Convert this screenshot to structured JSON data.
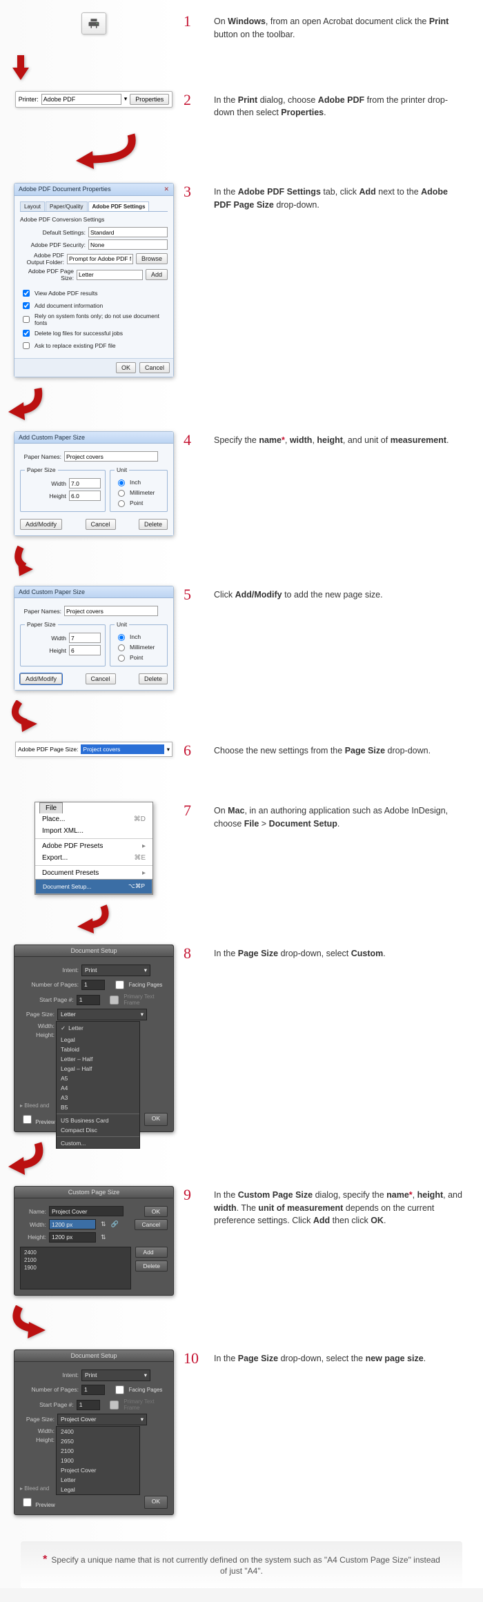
{
  "steps": [
    {
      "n": "1",
      "html": "On <b>Windows</b>, from an open Acrobat document click the <b>Print</b> button on the toolbar."
    },
    {
      "n": "2",
      "html": "In the <b>Print</b> dialog, choose <b>Adobe PDF</b> from the printer drop-down then select <b>Properties</b>."
    },
    {
      "n": "3",
      "html": "In the <b>Adobe PDF Settings</b> tab, click <b>Add</b> next to the <b>Adobe PDF Page Size</b> drop-down."
    },
    {
      "n": "4",
      "html": "Specify the <b>name</b><span class='ast'>*</span>, <b>width</b>, <b>height</b>, and unit of <b>measurement</b>."
    },
    {
      "n": "5",
      "html": "Click <b>Add/Modify</b> to add the new page size."
    },
    {
      "n": "6",
      "html": "Choose the new settings from the <b>Page Size</b> drop-down."
    },
    {
      "n": "7",
      "html": " On <b>Mac</b>, in an authoring application such as Adobe InDesign, choose <b>File</b> > <b>Document Setup</b>."
    },
    {
      "n": "8",
      "html": "In the <b>Page Size</b> drop-down, select <b>Custom</b>."
    },
    {
      "n": "9",
      "html": "In the <b>Custom Page Size</b> dialog, specify the <b>name</b><span class='ast'>*</span>, <b>height</b>, and <b>width</b>. The <b>unit of measurement</b> depends on the current preference settings. Click <b>Add</b> then click <b>OK</b>."
    },
    {
      "n": "10",
      "html": "In the <b>Page Size</b> drop-down, select the <b>new page size</b>."
    }
  ],
  "printerbar": {
    "label": "Printer:",
    "value": "Adobe PDF",
    "btn": "Properties"
  },
  "propdlg": {
    "title": "Adobe PDF Document Properties",
    "tabs": [
      "Layout",
      "Paper/Quality",
      "Adobe PDF Settings"
    ],
    "subtitle": "Adobe PDF Conversion Settings",
    "rows": [
      {
        "l": "Default Settings:",
        "v": "Standard"
      },
      {
        "l": "Adobe PDF Security:",
        "v": "None"
      },
      {
        "l": "Adobe PDF Output Folder:",
        "v": "Prompt for Adobe PDF filename",
        "b": "Browse"
      },
      {
        "l": "Adobe PDF Page Size:",
        "v": "Letter",
        "b": "Add"
      }
    ],
    "chks": [
      "View Adobe PDF results",
      "Add document information",
      "Rely on system fonts only; do not use document fonts",
      "Delete log files for successful jobs",
      "Ask to replace existing PDF file"
    ],
    "ok": "OK",
    "cancel": "Cancel"
  },
  "addpaper": {
    "title": "Add Custom Paper Size",
    "pn": "Paper Names:",
    "pnv": "Project covers",
    "ps": "Paper Size",
    "w": "Width",
    "wv1": "7.0",
    "wv2": "7",
    "h": "Height",
    "hv1": "6.0",
    "hv2": "6",
    "unit": "Unit",
    "units": [
      "Inch",
      "Millimeter",
      "Point"
    ],
    "am": "Add/Modify",
    "cancel": "Cancel",
    "delete": "Delete"
  },
  "pagesel": {
    "label": "Adobe PDF Page Size:",
    "value": "Project covers"
  },
  "filemenu": {
    "title": "File",
    "items": [
      {
        "t": "Place...",
        "k": "⌘D"
      },
      {
        "t": "Import XML..."
      },
      {
        "sep": true
      },
      {
        "t": "Adobe PDF Presets",
        "sub": true
      },
      {
        "t": "Export...",
        "k": "⌘E"
      },
      {
        "sep": true
      },
      {
        "t": "Document Presets",
        "sub": true
      },
      {
        "t": "Document Setup...",
        "k": "⌥⌘P",
        "sel": true
      }
    ]
  },
  "docsetup": {
    "title": "Document Setup",
    "intent": "Intent:",
    "intentv": "Print",
    "np": "Number of Pages:",
    "npv": "1",
    "sp": "Start Page #:",
    "spv": "1",
    "fp": "Facing Pages",
    "ptf": "Primary Text Frame",
    "ps": "Page Size:",
    "psv": "Letter",
    "w": "Width:",
    "h": "Height:",
    "bleed": "Bleed and",
    "prev": "Preview",
    "ok": "OK",
    "opts": [
      "Letter",
      "Legal",
      "Tabloid",
      "Letter – Half",
      "Legal – Half",
      "A5",
      "A4",
      "A3",
      "B5",
      "",
      "US Business Card",
      "Compact Disc",
      "",
      "Custom..."
    ]
  },
  "custsize": {
    "title": "Custom Page Size",
    "name": "Name:",
    "namev": "Project Cover",
    "w": "Width:",
    "wv": "1200 px",
    "h": "Height:",
    "hv": "1200 px",
    "ok": "OK",
    "cancel": "Cancel",
    "add": "Add",
    "delete": "Delete",
    "list": [
      "2400",
      "2100",
      "1900"
    ]
  },
  "docsetup2": {
    "psv": "Project Cover",
    "opts": [
      "2400",
      "2650",
      "2100",
      "1900",
      "Project Cover",
      "Letter",
      "Legal"
    ]
  },
  "footnote": "Specify a unique name that is not currently defined on the system such as \"A4 Custom Page Size\" instead of just \"A4\"."
}
